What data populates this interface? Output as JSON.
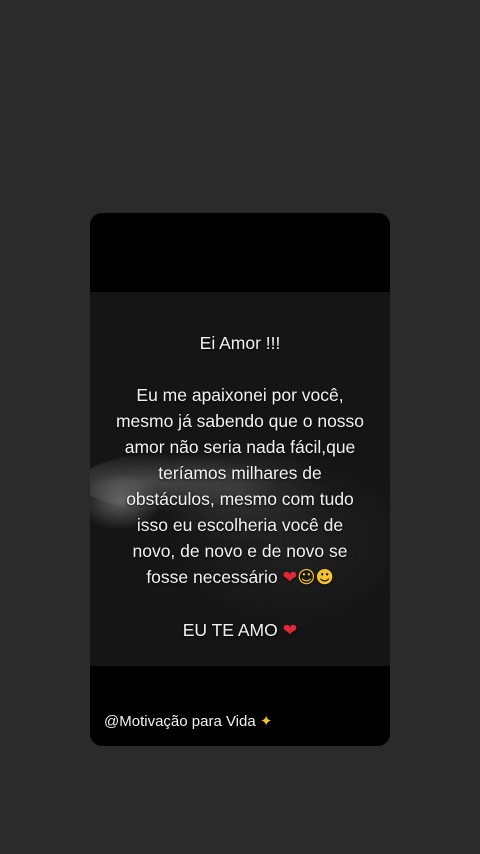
{
  "story": {
    "title": "Ei Amor !!!",
    "body_lines": [
      "Eu me apaixonei por você,",
      "mesmo já sabendo que o nosso",
      "amor não seria nada fácil,que",
      "teríamos milhares de",
      "obstáculos, mesmo com tudo",
      "isso eu escolheria você de",
      "novo, de novo e de novo se",
      "fosse necessário"
    ],
    "closing": "EU TE AMO",
    "emoji_heart": "❤",
    "emoji_face_tear": "☺",
    "emoji_face_hearts": "☻",
    "watermark": "@Motivação para Vida",
    "watermark_icon": "✦"
  },
  "colors": {
    "background": "#2c2b2c",
    "card": "#000000",
    "heart": "#e0283a"
  }
}
